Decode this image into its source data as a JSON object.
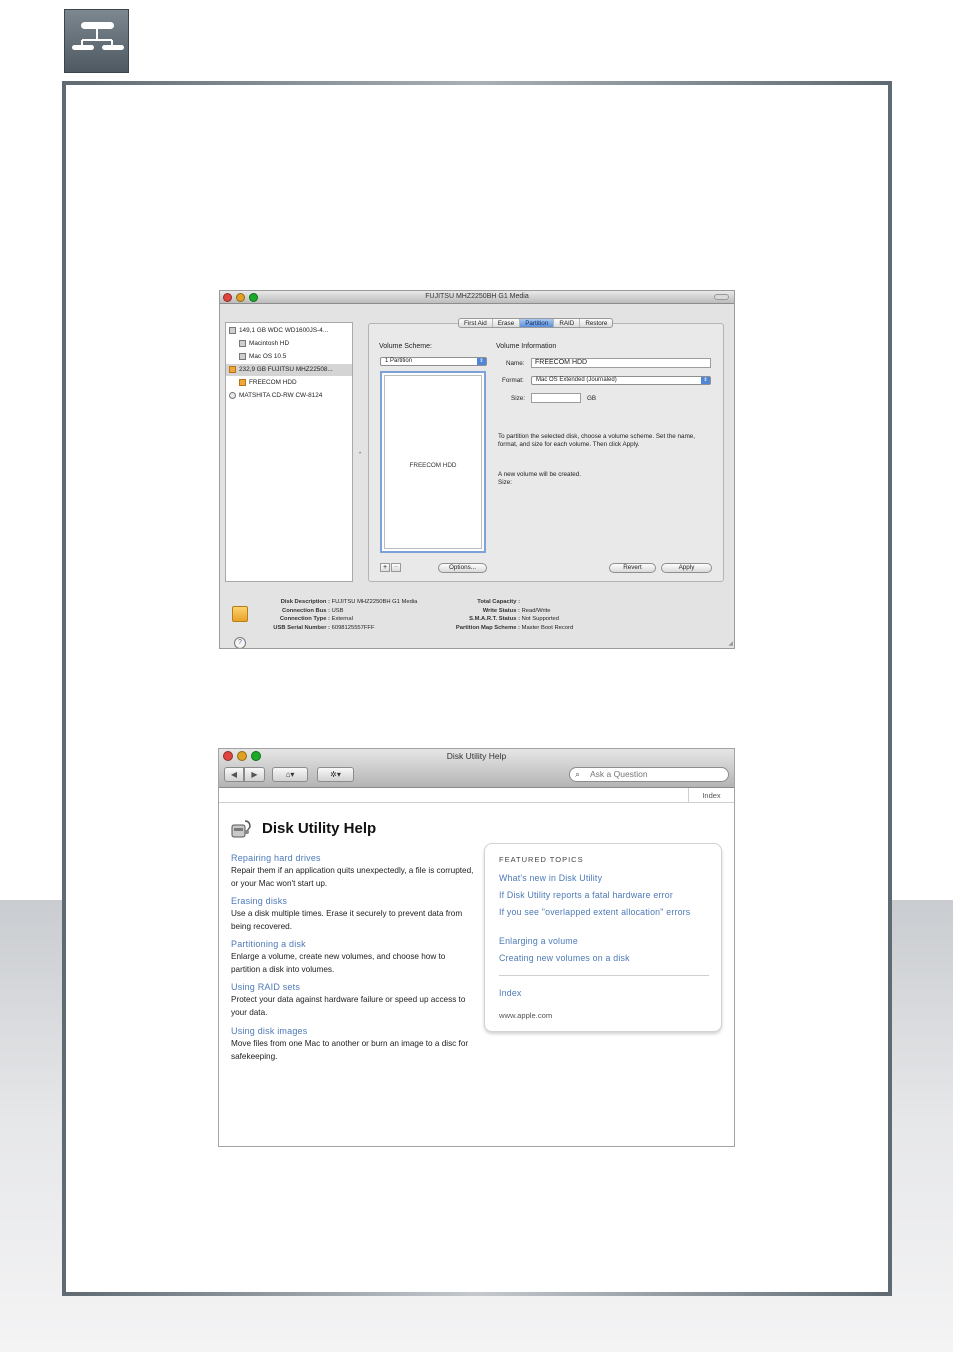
{
  "disk_utility": {
    "title": "FUJITSU MHZ2250BH G1 Media",
    "sidebar": [
      {
        "label": "149,1 GB WDC WD1600JS-4...",
        "icon": "hard-disk-icon"
      },
      {
        "label": "Macintosh HD",
        "icon": "volume-icon"
      },
      {
        "label": "Mac OS 10.5",
        "icon": "volume-icon"
      },
      {
        "label": "232,9 GB FUJITSU MHZ22508...",
        "icon": "external-disk-icon"
      },
      {
        "label": "FREECOM HDD",
        "icon": "external-volume-icon"
      },
      {
        "label": "MATSHITA CD-RW CW-8124",
        "icon": "optical-drive-icon"
      }
    ],
    "tabs": [
      "First Aid",
      "Erase",
      "Partition",
      "RAID",
      "Restore"
    ],
    "active_tab": "Partition",
    "volume_scheme_label": "Volume Scheme:",
    "volume_scheme_value": "1 Partition",
    "volume_info_label": "Volume Information",
    "name_label": "Name:",
    "name_value": "FREECOM HDD",
    "format_label": "Format:",
    "format_value": "Mac OS Extended (Journaled)",
    "size_label": "Size:",
    "size_unit": "GB",
    "size_value": "",
    "volume_map_label": "FREECOM HDD",
    "instructions": "To partition the selected disk, choose a volume scheme. Set the name, format, and size for each volume. Then click Apply.",
    "new_volume_note": "A new volume will be created.",
    "new_volume_size": "Size:",
    "add_label": "+",
    "remove_label": "−",
    "options_label": "Options...",
    "revert_label": "Revert",
    "apply_label": "Apply",
    "details_left": [
      {
        "key": "Disk Description :",
        "value": "FUJITSU MHZ2250BH G1 Media"
      },
      {
        "key": "Connection Bus :",
        "value": "USB"
      },
      {
        "key": "Connection Type :",
        "value": "External"
      },
      {
        "key": "USB Serial Number :",
        "value": "6098125557FFF"
      }
    ],
    "details_right": [
      {
        "key": "Total Capacity :",
        "value": ""
      },
      {
        "key": "Write Status :",
        "value": "Read/Write"
      },
      {
        "key": "S.M.A.R.T. Status :",
        "value": "Not Supported"
      },
      {
        "key": "Partition Map Scheme :",
        "value": "Master Boot Record"
      }
    ],
    "help_button": "?"
  },
  "help_window": {
    "title": "Disk Utility Help",
    "search_placeholder": "Ask a Question",
    "index_tab": "Index",
    "heading": "Disk Utility Help",
    "topics": [
      {
        "link": "Repairing hard drives",
        "desc": "Repair them if an application quits unexpectedly, a file is corrupted, or your Mac won't start up."
      },
      {
        "link": "Erasing disks",
        "desc": "Use a disk multiple times. Erase it securely to prevent data from being recovered."
      },
      {
        "link": "Partitioning a disk",
        "desc": "Enlarge a volume, create new volumes, and choose how to partition a disk into volumes."
      },
      {
        "link": "Using RAID sets",
        "desc": "Protect your data against hardware failure or speed up access to your data."
      },
      {
        "link": "Using disk images",
        "desc": "Move files from one Mac to another or burn an image to a disc for safekeeping."
      }
    ],
    "featured_heading": "FEATURED TOPICS",
    "featured": [
      "What's new in Disk Utility",
      "If Disk Utility reports a fatal hardware error",
      "If you see \"overlapped extent allocation\" errors",
      "Enlarging a volume",
      "Creating new volumes on a disk"
    ],
    "index_link": "Index",
    "apple_link": "www.apple.com"
  },
  "colors": {
    "frame": "#5f6a73",
    "link": "#4d7ab8",
    "selection": "#5b8fdb"
  }
}
